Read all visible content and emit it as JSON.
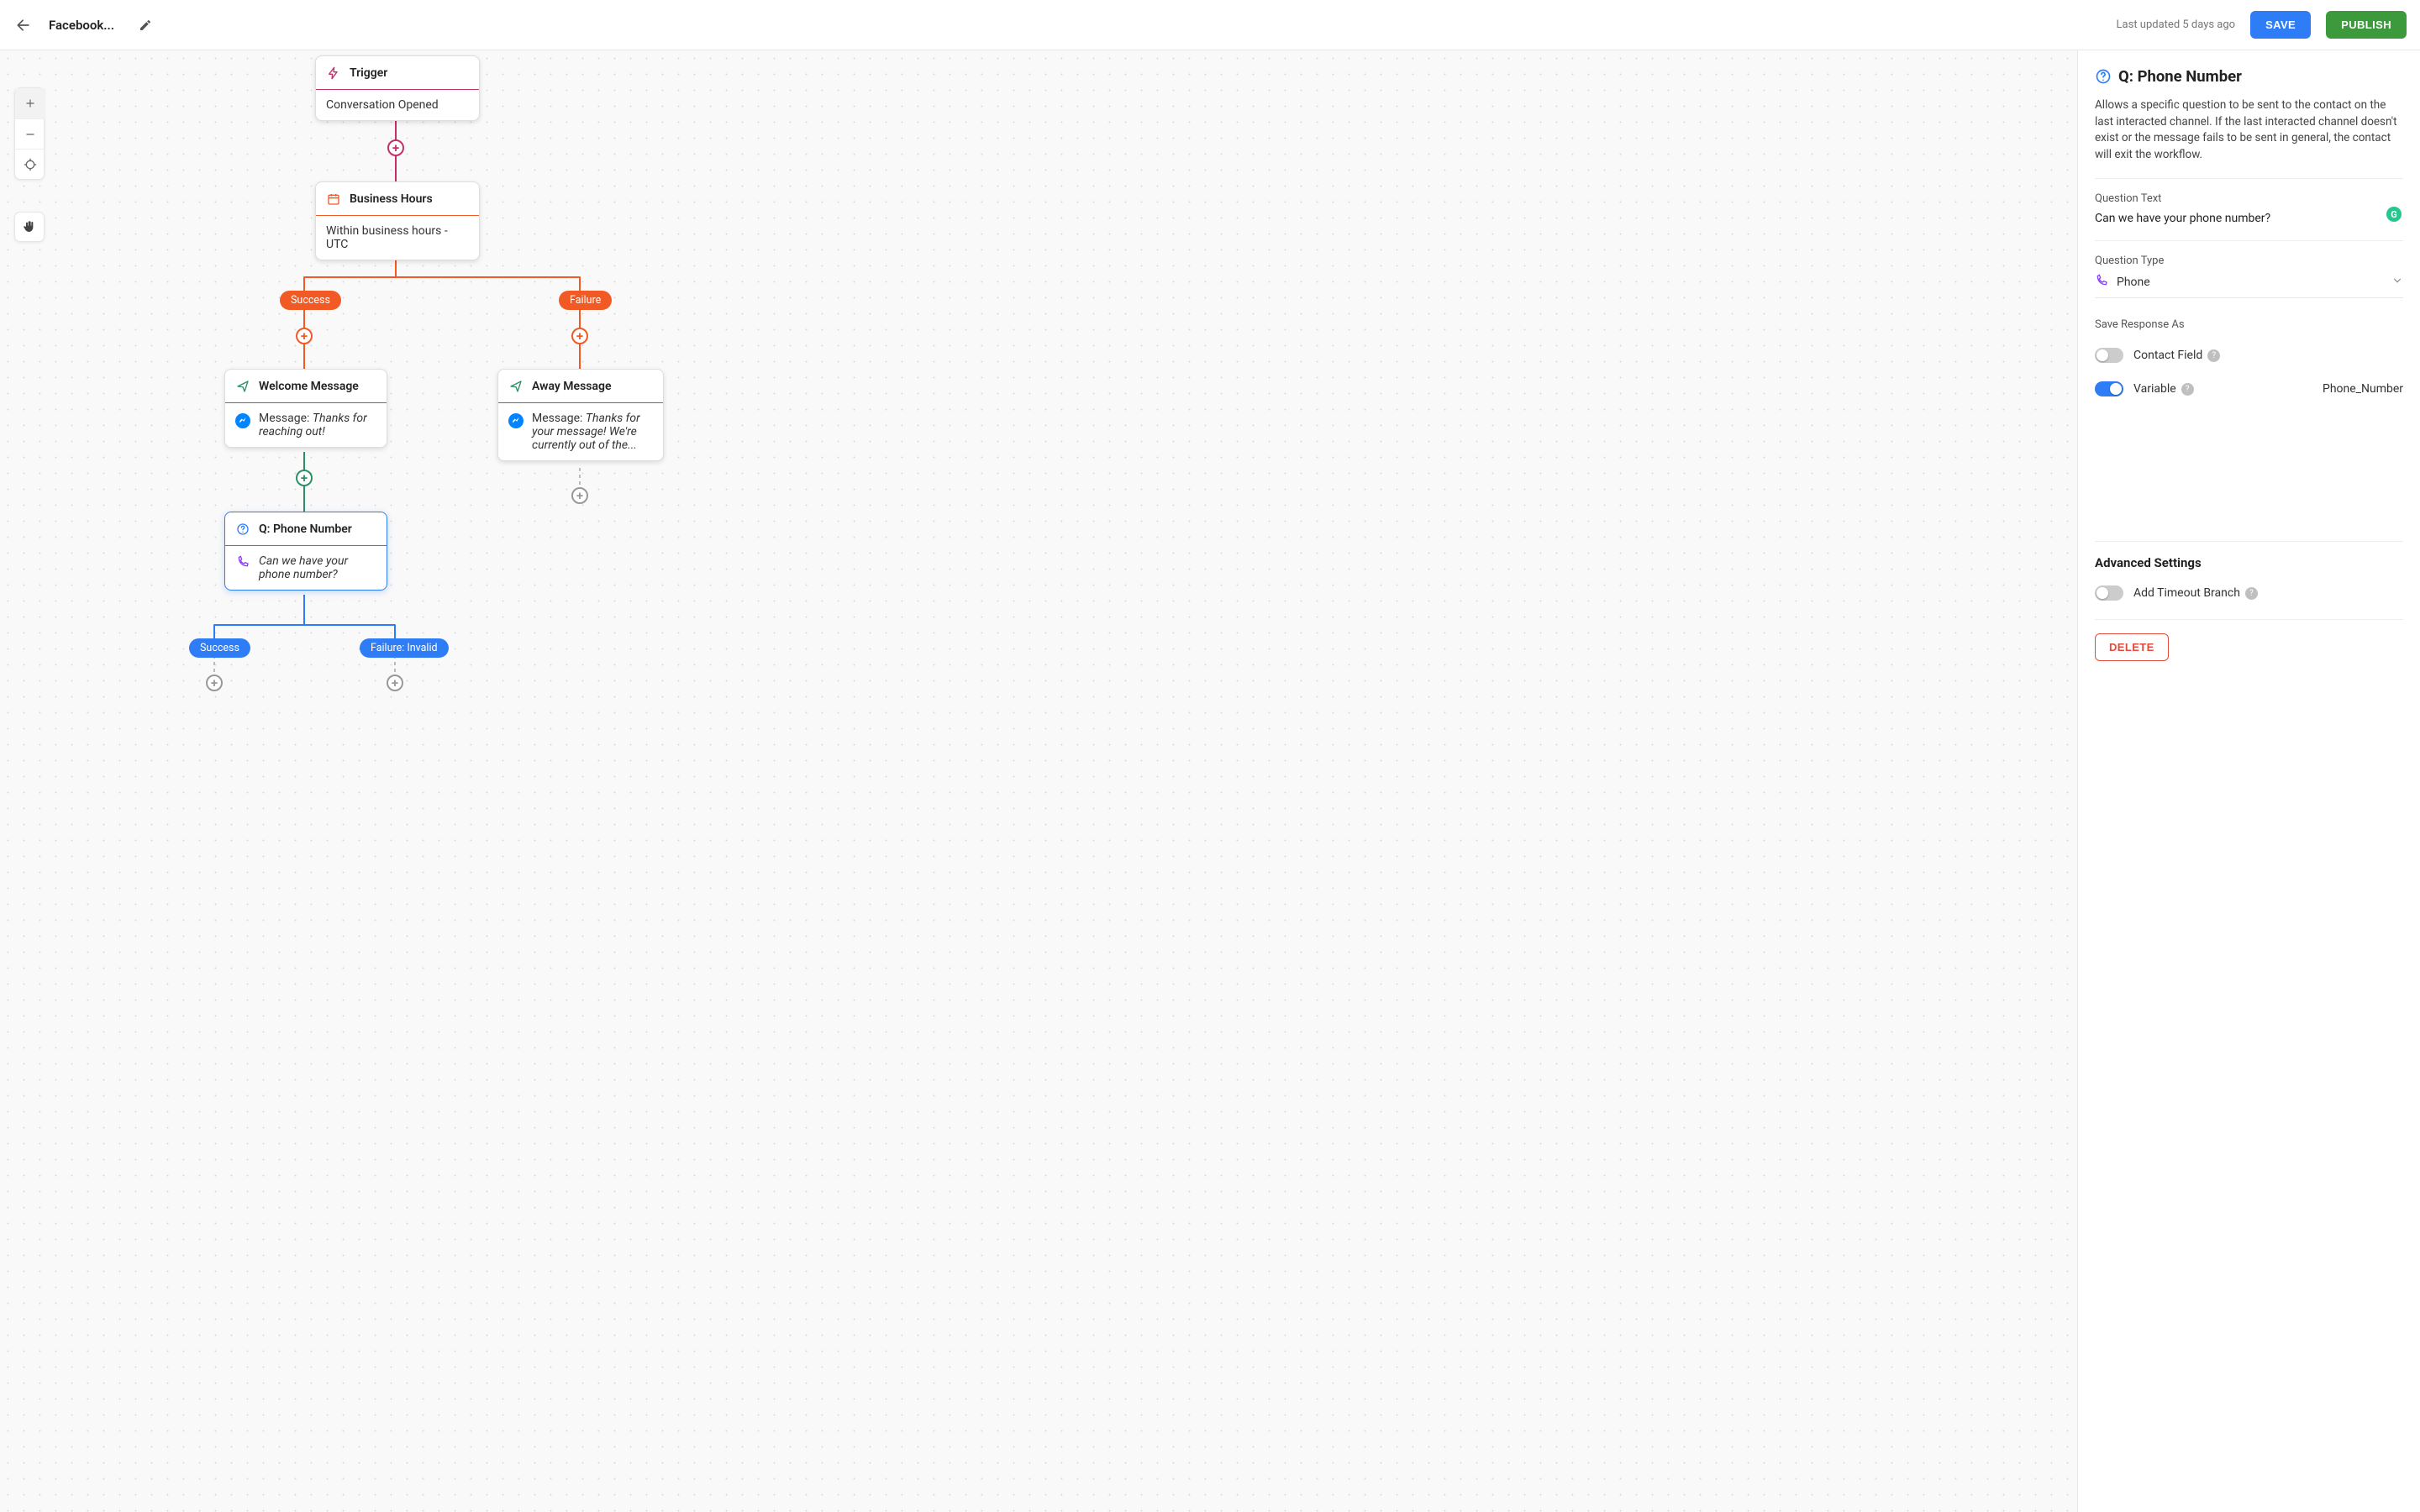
{
  "header": {
    "title": "Facebook...",
    "last_updated": "Last updated 5 days ago",
    "save": "SAVE",
    "publish": "PUBLISH"
  },
  "flow": {
    "trigger": {
      "label": "Trigger",
      "subtitle": "Conversation Opened"
    },
    "business_hours": {
      "label": "Business Hours",
      "subtitle": "Within business hours - UTC"
    },
    "branches": {
      "success": "Success",
      "failure": "Failure"
    },
    "welcome": {
      "label": "Welcome Message",
      "prefix": "Message: ",
      "body": "Thanks for reaching out!"
    },
    "away": {
      "label": "Away Message",
      "prefix": "Message: ",
      "body": "Thanks for your message! We're currently out of the..."
    },
    "question": {
      "label": "Q: Phone Number",
      "body": "Can we have your phone number?"
    },
    "q_branches": {
      "success": "Success",
      "failure": "Failure: Invalid"
    }
  },
  "sidepanel": {
    "title": "Q: Phone Number",
    "description": "Allows a specific question to be sent to the contact on the last interacted channel. If the last interacted channel doesn't exist or the message fails to be sent in general, the contact will exit the workflow.",
    "question_text_label": "Question Text",
    "question_text_value": "Can we have your phone number?",
    "question_type_label": "Question Type",
    "question_type_value": "Phone",
    "save_response_label": "Save Response As",
    "contact_field_label": "Contact Field",
    "variable_label": "Variable",
    "variable_name": "Phone_Number",
    "advanced_label": "Advanced Settings",
    "timeout_label": "Add Timeout Branch",
    "delete": "DELETE"
  }
}
